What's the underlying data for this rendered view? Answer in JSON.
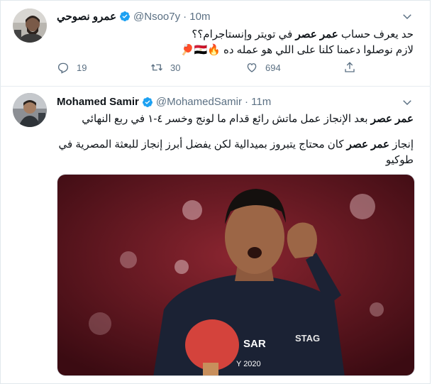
{
  "tweet1": {
    "name": "عمرو نصوحي",
    "handle": "@Nsoo7y",
    "time": "· 10m",
    "line1_prefix": "حد يعرف حساب",
    "line1_highlight": "عمر عصر",
    "line1_suffix": "في تويتر وإنستاجرام؟؟",
    "line2": "لازم نوصلوا دعمنا كلنا على اللي هو عمله ده 🔥🇪🇬🏓",
    "actions": {
      "replies": "19",
      "retweets": "30",
      "likes": "694"
    }
  },
  "tweet2": {
    "name": "Mohamed Samir",
    "handle": "@MohamedSamir",
    "time": "· 11m",
    "p1_highlight": "عمر عصر",
    "p1_rest": "بعد الإنجاز عمل ماتش رائع قدام ما لونج وخسر ٤-١ في ربع النهائي",
    "p2_prefix": "إنجاز",
    "p2_highlight": "عمر عصر",
    "p2_rest": "كان محتاج يتبروز بميدالية لكن يفضل أبرز إنجاز للبعثة المصرية في طوكيو",
    "jersey_text": "SAR",
    "jersey_logo": "STAG",
    "jersey_year": "Y 2020"
  },
  "colors": {
    "accent": "#1da1f2",
    "muted": "#5b7083",
    "text": "#0f1419",
    "border": "#e6ecf0"
  },
  "icons": [
    "verified-badge-icon",
    "chevron-down-icon",
    "reply-icon",
    "retweet-icon",
    "like-icon",
    "share-icon"
  ]
}
